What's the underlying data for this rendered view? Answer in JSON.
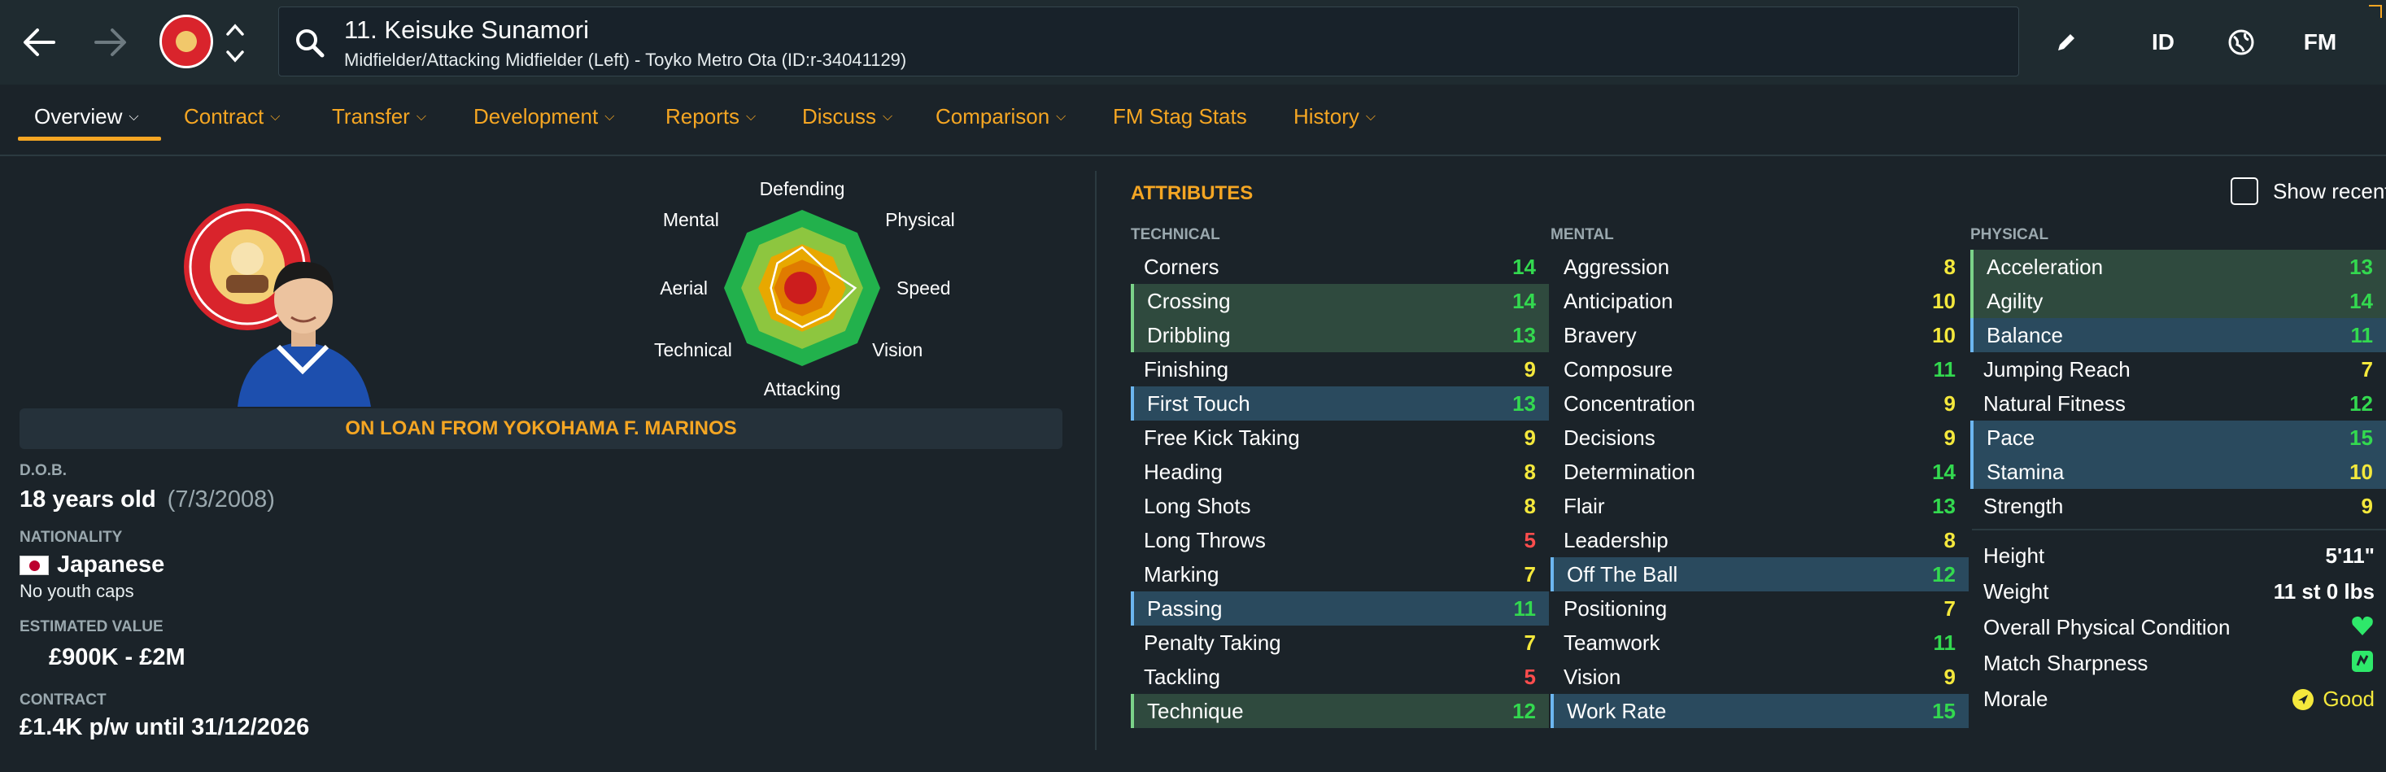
{
  "header": {
    "player_name": "11. Keisuke Sunamori",
    "player_subtitle": "Midfielder/Attacking Midfielder (Left) - Toyko Metro Ota (ID:r-34041129)",
    "id_label": "ID",
    "fm_label": "FM"
  },
  "tabs": [
    {
      "label": "Overview"
    },
    {
      "label": "Contract"
    },
    {
      "label": "Transfer"
    },
    {
      "label": "Development"
    },
    {
      "label": "Reports"
    },
    {
      "label": "Discuss"
    },
    {
      "label": "Comparison"
    },
    {
      "label": "FM Stag Stats"
    },
    {
      "label": "History"
    }
  ],
  "profile": {
    "loan_banner": "ON LOAN FROM YOKOHAMA F. MARINOS",
    "dob_label": "D.O.B.",
    "age": "18 years old",
    "dob": "(7/3/2008)",
    "nationality_label": "NATIONALITY",
    "nationality": "Japanese",
    "youth_caps": "No youth caps",
    "value_label": "ESTIMATED VALUE",
    "value": "£900K - £2M",
    "contract_label": "CONTRACT",
    "contract": "£1.4K p/w until 31/12/2026"
  },
  "radar": {
    "labels": [
      "Defending",
      "Physical",
      "Speed",
      "Vision",
      "Attacking",
      "Technical",
      "Aerial",
      "Mental"
    ],
    "levels": [
      0.52,
      0.38,
      0.68,
      0.48,
      0.5,
      0.45,
      0.4,
      0.45
    ],
    "colors": {
      "outer": "#22b14c",
      "ring2": "#8dc63f",
      "ring3": "#e8a800",
      "ring4": "#e07b00",
      "core": "#cc1d1d"
    }
  },
  "attributes": {
    "title": "ATTRIBUTES",
    "show_recent": "Show recent",
    "technical_label": "TECHNICAL",
    "mental_label": "MENTAL",
    "physical_label": "PHYSICAL",
    "technical": [
      {
        "name": "Corners",
        "value": "14",
        "hl": ""
      },
      {
        "name": "Crossing",
        "value": "14",
        "hl": "green"
      },
      {
        "name": "Dribbling",
        "value": "13",
        "hl": "green"
      },
      {
        "name": "Finishing",
        "value": "9",
        "hl": ""
      },
      {
        "name": "First Touch",
        "value": "13",
        "hl": "blue"
      },
      {
        "name": "Free Kick Taking",
        "value": "9",
        "hl": ""
      },
      {
        "name": "Heading",
        "value": "8",
        "hl": ""
      },
      {
        "name": "Long Shots",
        "value": "8",
        "hl": ""
      },
      {
        "name": "Long Throws",
        "value": "5",
        "hl": ""
      },
      {
        "name": "Marking",
        "value": "7",
        "hl": ""
      },
      {
        "name": "Passing",
        "value": "11",
        "hl": "blue"
      },
      {
        "name": "Penalty Taking",
        "value": "7",
        "hl": ""
      },
      {
        "name": "Tackling",
        "value": "5",
        "hl": ""
      },
      {
        "name": "Technique",
        "value": "12",
        "hl": "green"
      }
    ],
    "mental": [
      {
        "name": "Aggression",
        "value": "8",
        "hl": ""
      },
      {
        "name": "Anticipation",
        "value": "10",
        "hl": ""
      },
      {
        "name": "Bravery",
        "value": "10",
        "hl": ""
      },
      {
        "name": "Composure",
        "value": "11",
        "hl": ""
      },
      {
        "name": "Concentration",
        "value": "9",
        "hl": ""
      },
      {
        "name": "Decisions",
        "value": "9",
        "hl": ""
      },
      {
        "name": "Determination",
        "value": "14",
        "hl": ""
      },
      {
        "name": "Flair",
        "value": "13",
        "hl": ""
      },
      {
        "name": "Leadership",
        "value": "8",
        "hl": ""
      },
      {
        "name": "Off The Ball",
        "value": "12",
        "hl": "blue"
      },
      {
        "name": "Positioning",
        "value": "7",
        "hl": ""
      },
      {
        "name": "Teamwork",
        "value": "11",
        "hl": ""
      },
      {
        "name": "Vision",
        "value": "9",
        "hl": ""
      },
      {
        "name": "Work Rate",
        "value": "15",
        "hl": "blue"
      }
    ],
    "physical": [
      {
        "name": "Acceleration",
        "value": "13",
        "hl": "green"
      },
      {
        "name": "Agility",
        "value": "14",
        "hl": "green"
      },
      {
        "name": "Balance",
        "value": "11",
        "hl": "blue"
      },
      {
        "name": "Jumping Reach",
        "value": "7",
        "hl": ""
      },
      {
        "name": "Natural Fitness",
        "value": "12",
        "hl": ""
      },
      {
        "name": "Pace",
        "value": "15",
        "hl": "blue"
      },
      {
        "name": "Stamina",
        "value": "10",
        "hl": "blue"
      },
      {
        "name": "Strength",
        "value": "9",
        "hl": ""
      }
    ],
    "physical_extra": {
      "height_label": "Height",
      "height": "5'11\"",
      "weight_label": "Weight",
      "weight": "11 st 0 lbs",
      "condition_label": "Overall Physical Condition",
      "sharpness_label": "Match Sharpness",
      "morale_label": "Morale",
      "morale": "Good"
    }
  },
  "colors": {
    "accent": "#f5a623",
    "value_high": "#33d94f",
    "value_mid": "#f4e83c",
    "value_low": "#ff4d4d",
    "status_green": "#2ee86a"
  }
}
